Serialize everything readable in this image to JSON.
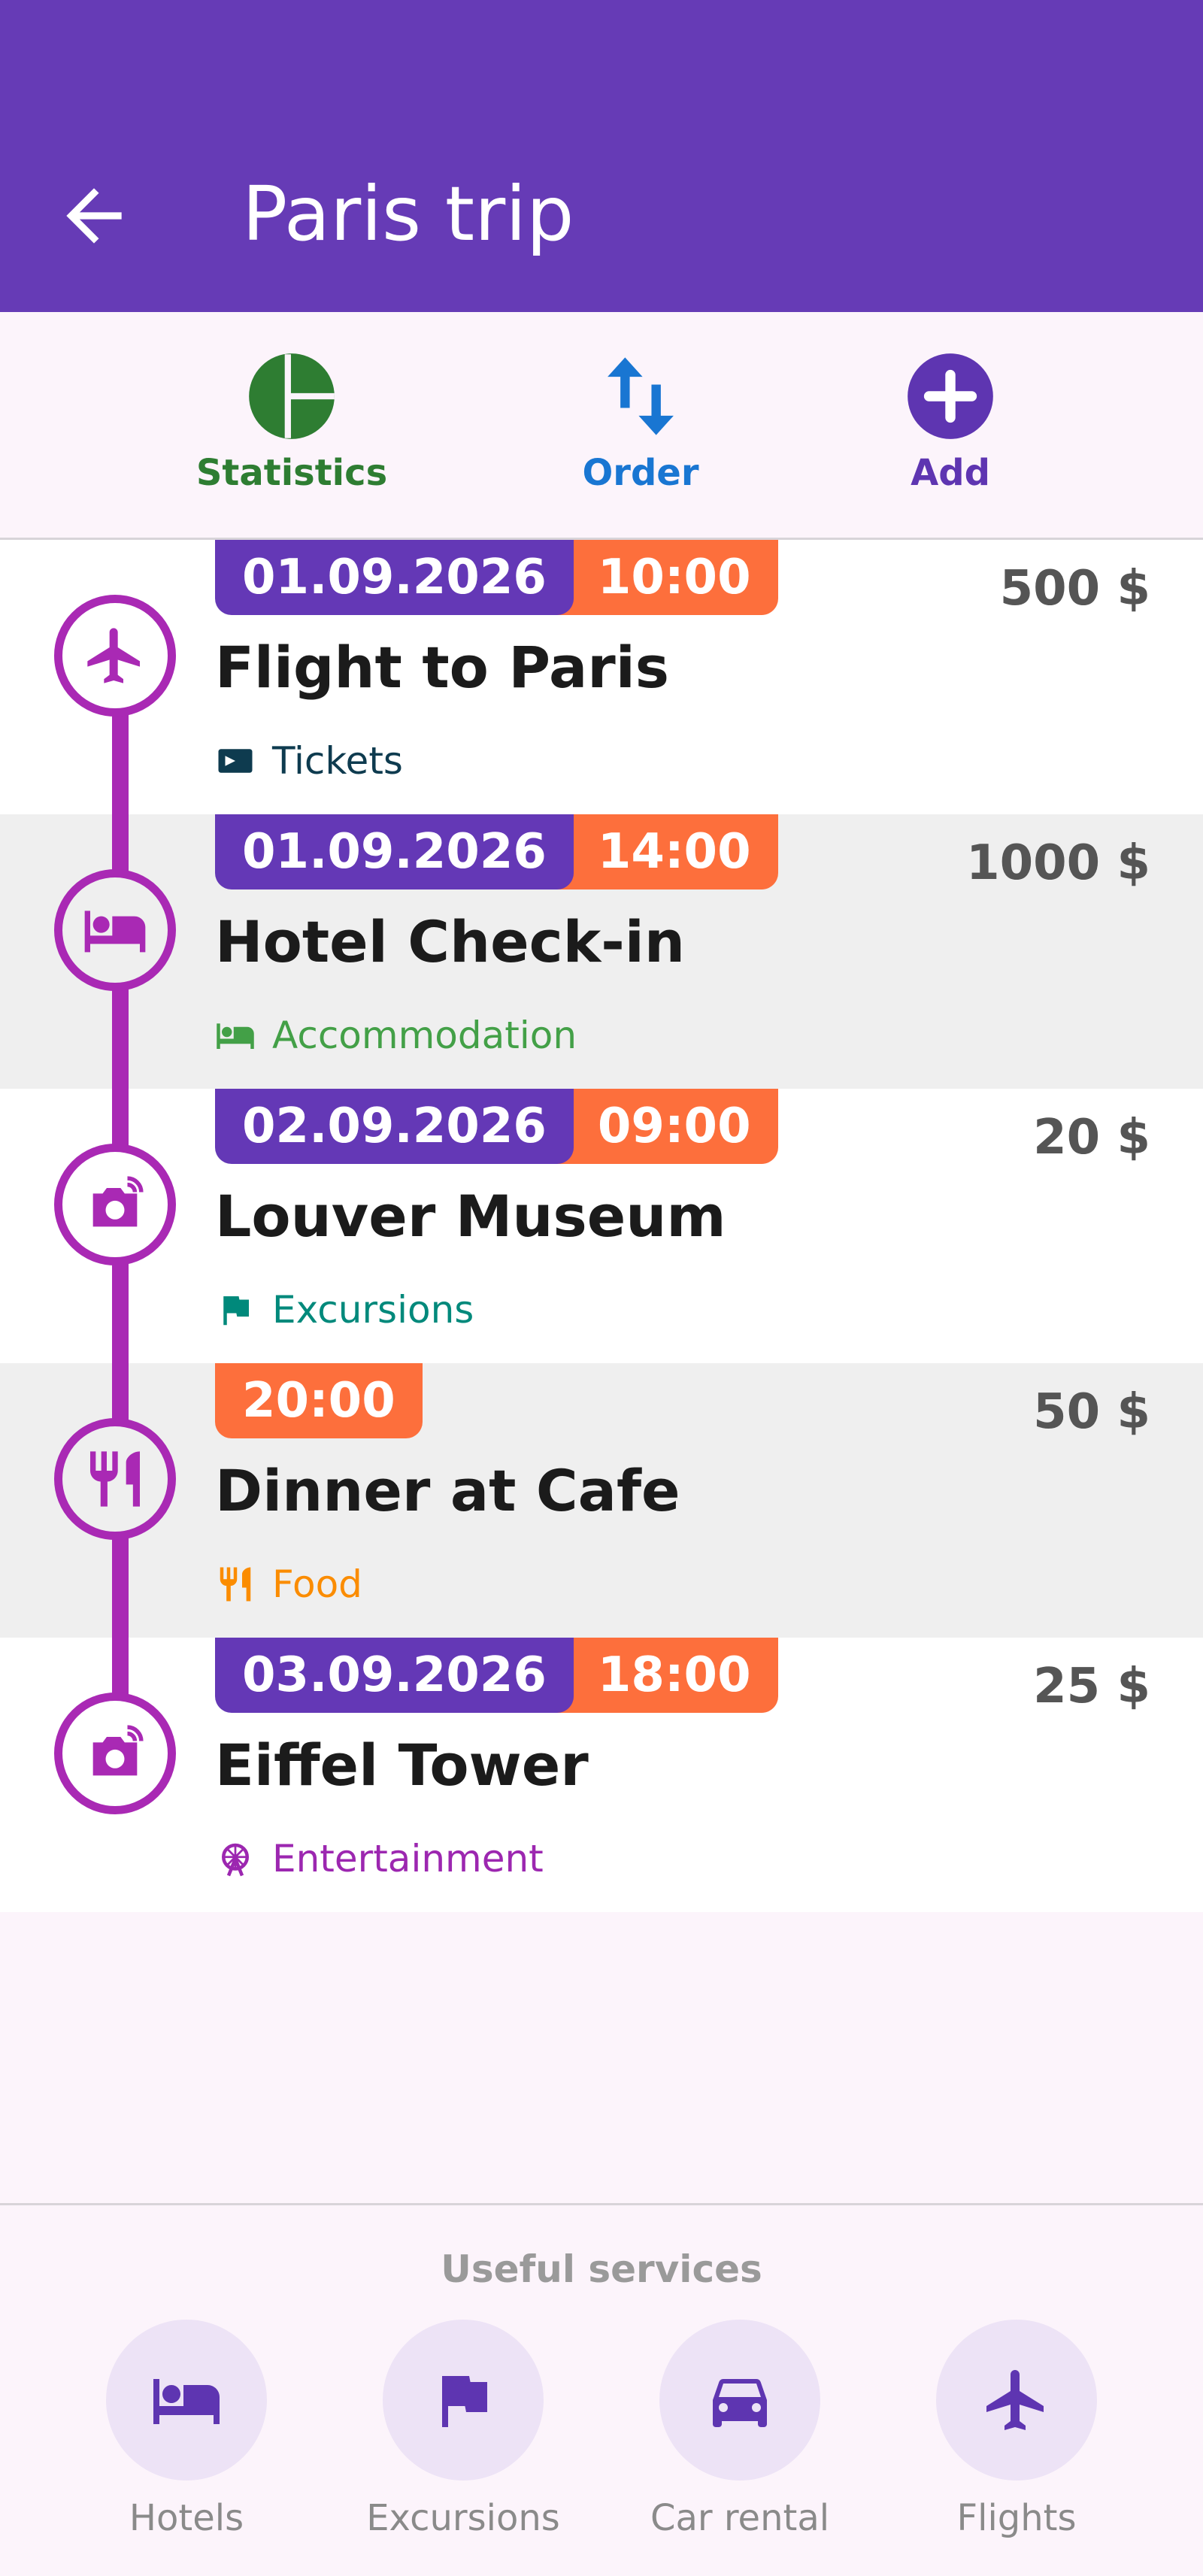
{
  "header": {
    "title": "Paris trip"
  },
  "colors": {
    "primary": "#663bb6",
    "timeline": "#a929b4",
    "date_badge": "#6438b6",
    "time_badge": "#fd6f3c",
    "statistics": "#2e7d32",
    "order": "#1976d2",
    "add": "#5e35b1"
  },
  "toolbar": {
    "statistics_label": "Statistics",
    "order_label": "Order",
    "add_label": "Add"
  },
  "events": [
    {
      "date": "01.09.2026",
      "time": "10:00",
      "title": "Flight to Paris",
      "amount": "500 $",
      "category": "Tickets",
      "category_color": "#0e3b4f",
      "icon": "airplane-icon",
      "category_icon": "ticket-icon"
    },
    {
      "date": "01.09.2026",
      "time": "14:00",
      "title": "Hotel Check-in",
      "amount": "1000 $",
      "category": "Accommodation",
      "category_color": "#43a047",
      "icon": "bed-icon",
      "category_icon": "bed-icon"
    },
    {
      "date": "02.09.2026",
      "time": "09:00",
      "title": "Louver Museum",
      "amount": "20 $",
      "category": "Excursions",
      "category_color": "#00897b",
      "icon": "camera-icon",
      "category_icon": "flag-icon"
    },
    {
      "date": "",
      "time": "20:00",
      "title": "Dinner at Cafe",
      "amount": "50 $",
      "category": "Food",
      "category_color": "#fb8c00",
      "icon": "restaurant-icon",
      "category_icon": "restaurant-icon"
    },
    {
      "date": "03.09.2026",
      "time": "18:00",
      "title": "Eiffel Tower",
      "amount": "25 $",
      "category": "Entertainment",
      "category_color": "#9c27b0",
      "icon": "camera-icon",
      "category_icon": "ferris-wheel-icon"
    }
  ],
  "services": {
    "title": "Useful services",
    "items": [
      {
        "label": "Hotels",
        "icon": "bed-icon"
      },
      {
        "label": "Excursions",
        "icon": "flag-icon"
      },
      {
        "label": "Car rental",
        "icon": "car-icon"
      },
      {
        "label": "Flights",
        "icon": "airplane-icon"
      }
    ]
  }
}
